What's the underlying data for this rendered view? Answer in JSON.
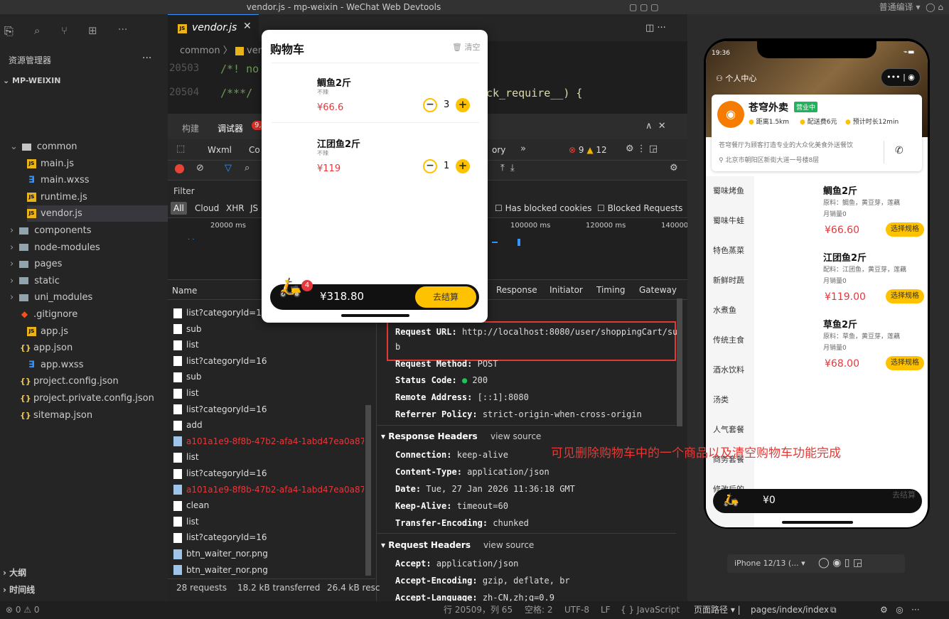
{
  "window": {
    "title": "vendor.js - mp-weixin - WeChat Web Devtools",
    "compile_mode": "普通编译 ▾"
  },
  "sidebar": {
    "header": "资源管理器",
    "project": "MP-WEIXIN",
    "items": [
      {
        "label": "common",
        "kind": "folder-open"
      },
      {
        "label": "main.js",
        "kind": "js"
      },
      {
        "label": "main.wxss",
        "kind": "css"
      },
      {
        "label": "runtime.js",
        "kind": "js"
      },
      {
        "label": "vendor.js",
        "kind": "js"
      },
      {
        "label": "components",
        "kind": "folder"
      },
      {
        "label": "node-modules",
        "kind": "folder"
      },
      {
        "label": "pages",
        "kind": "folder"
      },
      {
        "label": "static",
        "kind": "folder"
      },
      {
        "label": "uni_modules",
        "kind": "folder"
      },
      {
        "label": ".gitignore",
        "kind": "git"
      },
      {
        "label": "app.js",
        "kind": "js"
      },
      {
        "label": "app.json",
        "kind": "json"
      },
      {
        "label": "app.wxss",
        "kind": "css"
      },
      {
        "label": "project.config.json",
        "kind": "json"
      },
      {
        "label": "project.private.config.json",
        "kind": "json"
      },
      {
        "label": "sitemap.json",
        "kind": "json"
      }
    ],
    "outline": "大纲",
    "timeline": "时间线"
  },
  "editor": {
    "tab": "vendor.js",
    "breadcrumb": "common",
    "breadcrumb_file": "ven",
    "lines": [
      {
        "num": "20503",
        "code": "/*! no"
      },
      {
        "num": "20504",
        "code": "/***/"
      }
    ],
    "code_tail": "ck_require__) {"
  },
  "devtools": {
    "tabs": [
      "构建",
      "调试器"
    ],
    "error_badge": "9,",
    "panel_tab_tail": "ory",
    "errors": "9",
    "warnings": "12",
    "panels": [
      "Wxml",
      "Co"
    ],
    "filter_label": "Filter",
    "filter_types": [
      "All",
      "Cloud",
      "XHR",
      "JS"
    ],
    "blocked_cookies": "Has blocked cookies",
    "blocked_requests": "Blocked Requests",
    "timeline_labels": [
      "20000 ms",
      "100000 ms",
      "120000 ms",
      "140000"
    ],
    "name_header": "Name",
    "detail_tabs": [
      "Response",
      "Initiator",
      "Timing",
      "Gateway"
    ],
    "requests": [
      "list?categoryId=16",
      "sub",
      "list",
      "list?categoryId=16",
      "sub",
      "list",
      "list?categoryId=16",
      "add",
      "a101a1e9-8f8b-47b2-afa4-1abd47ea0a87.pr",
      "list",
      "list?categoryId=16",
      "a101a1e9-8f8b-47b2-afa4-1abd47ea0a87.pr",
      "clean",
      "list",
      "list?categoryId=16",
      "btn_waiter_nor.png",
      "btn_waiter_nor.png"
    ],
    "summary": [
      "28 requests",
      "18.2 kB transferred",
      "26.4 kB resc"
    ],
    "general": {
      "request_url_label": "Request URL:",
      "request_url": "http://localhost:8080/user/shoppingCart/su",
      "request_url_wrap": "b",
      "method_label": "Request Method:",
      "method": "POST",
      "status_label": "Status Code:",
      "status": "200",
      "remote_label": "Remote Address:",
      "remote": "[::1]:8080",
      "referrer_label": "Referrer Policy:",
      "referrer": "strict-origin-when-cross-origin"
    },
    "response_headers_title": "Response Headers",
    "view_source": "view source",
    "response_headers": [
      {
        "k": "Connection:",
        "v": "keep-alive"
      },
      {
        "k": "Content-Type:",
        "v": "application/json"
      },
      {
        "k": "Date:",
        "v": "Tue, 27 Jan 2026 11:36:18 GMT"
      },
      {
        "k": "Keep-Alive:",
        "v": "timeout=60"
      },
      {
        "k": "Transfer-Encoding:",
        "v": "chunked"
      }
    ],
    "request_headers_title": "Request Headers",
    "request_headers": [
      {
        "k": "Accept:",
        "v": "application/json"
      },
      {
        "k": "Accept-Encoding:",
        "v": "gzip, deflate, br"
      },
      {
        "k": "Accept-Language:",
        "v": "zh-CN,zh;q=0.9"
      }
    ]
  },
  "annotation": "可见删除购物车中的一个商品以及清空购物车功能完成",
  "cart_popup": {
    "title": "购物车",
    "clear": "清空",
    "items": [
      {
        "name": "鲷鱼2斤",
        "flavor": "不辣",
        "price": "¥66.6",
        "qty": "3"
      },
      {
        "name": "江团鱼2斤",
        "flavor": "不辣",
        "price": "¥119",
        "qty": "1"
      }
    ],
    "badge": "4",
    "total": "¥318.80",
    "checkout": "去结算"
  },
  "phone": {
    "time": "19:36",
    "personal_center": "个人中心",
    "shop_name": "苍穹外卖",
    "shop_status": "营业中",
    "distance": "距离1.5km",
    "delivery_fee": "配送费6元",
    "eta": "预计时长12min",
    "slogan": "苍穹餐厅为顾客打造专业的大众化美食外送餐饮",
    "address": "北京市朝阳区新街大道一号楼8层",
    "categories": [
      "蜀味烤鱼",
      "蜀味牛蛙",
      "特色蒸菜",
      "新鲜时蔬",
      "水煮鱼",
      "传统主食",
      "酒水饮料",
      "汤类",
      "人气套餐",
      "商务套餐",
      "修改后的"
    ],
    "dishes": [
      {
        "name": "鲷鱼2斤",
        "desc": "原料：鲷鱼，黄豆芽，莲藕",
        "sales": "月销量0",
        "price": "¥66.60",
        "btn": "选择规格"
      },
      {
        "name": "江团鱼2斤",
        "desc": "配料：江团鱼，黄豆芽，莲藕",
        "sales": "月销量0",
        "price": "¥119.00",
        "btn": "选择规格"
      },
      {
        "name": "草鱼2斤",
        "desc": "原料：草鱼，黄豆芽，莲藕",
        "sales": "月销量0",
        "price": "¥68.00",
        "btn": "选择规格"
      }
    ],
    "cart_total": "¥0",
    "checkout": "去结算",
    "device": "iPhone 12/13 (...",
    "page_path_label": "页面路径",
    "page_path": "pages/index/index"
  },
  "statusbar": {
    "problems": "⊗ 0 ⚠ 0",
    "position": "行 20509，列 65",
    "spaces": "空格: 2",
    "encoding": "UTF-8",
    "eol": "LF",
    "language": "{ } JavaScript"
  },
  "colors": {
    "accent_red": "#e4393c",
    "highlight_box": "#e53935",
    "brand_yellow": "#ffc200"
  }
}
